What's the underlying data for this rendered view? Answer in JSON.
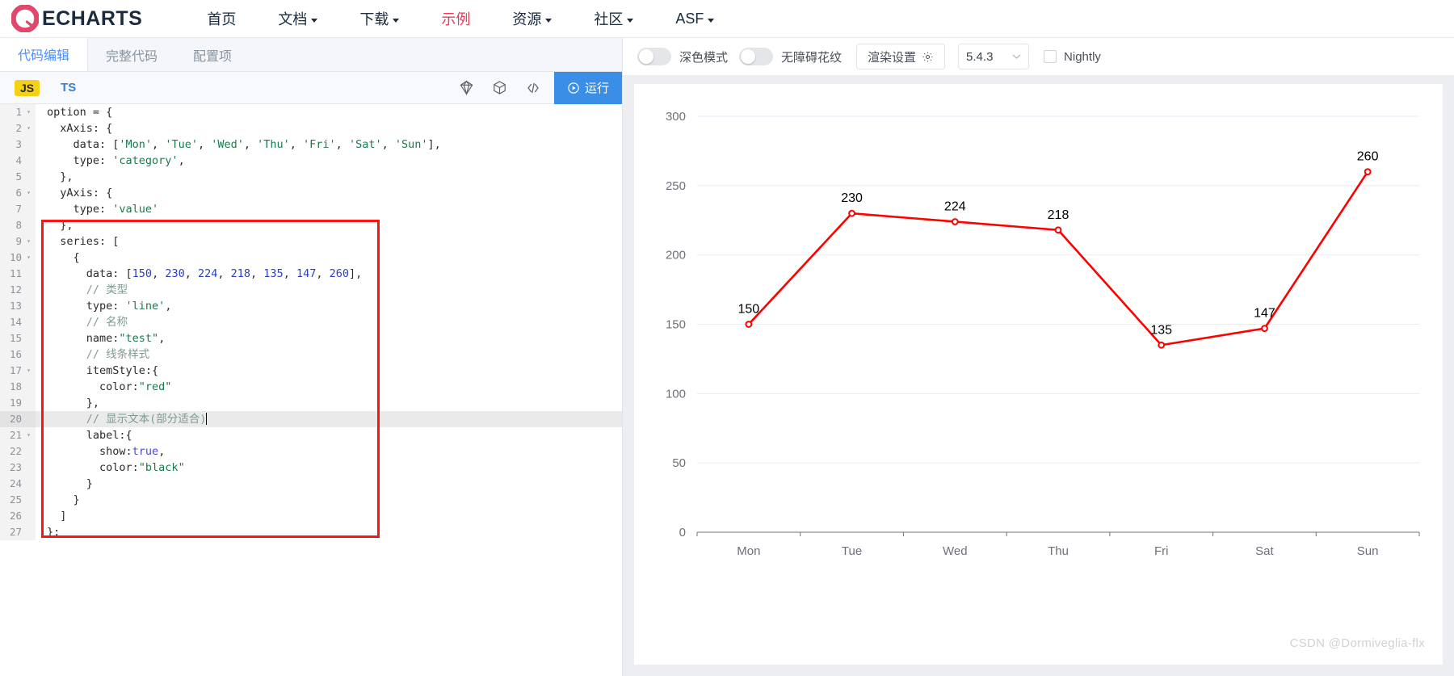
{
  "nav": {
    "brand": "ECHARTS",
    "items": [
      {
        "label": "首页",
        "caret": false,
        "active": false
      },
      {
        "label": "文档",
        "caret": true,
        "active": false
      },
      {
        "label": "下载",
        "caret": true,
        "active": false
      },
      {
        "label": "示例",
        "caret": false,
        "active": true
      },
      {
        "label": "资源",
        "caret": true,
        "active": false
      },
      {
        "label": "社区",
        "caret": true,
        "active": false
      },
      {
        "label": "ASF",
        "caret": true,
        "active": false
      }
    ],
    "accent_color": "#e43c59",
    "text_color": "#1b2a3c"
  },
  "editor_panel": {
    "tabs": [
      {
        "label": "代码编辑",
        "active": true
      },
      {
        "label": "完整代码",
        "active": false
      },
      {
        "label": "配置项",
        "active": false
      }
    ],
    "toolbar": {
      "js_label": "JS",
      "ts_label": "TS",
      "run_label": "运行",
      "icons": [
        "gem-icon",
        "cube-icon",
        "code-brackets-icon"
      ]
    },
    "highlight_box_color": "#fb1414",
    "active_line": 20,
    "lines": [
      {
        "n": 1,
        "fold": true,
        "segs": [
          {
            "t": "option ",
            "c": "pun"
          },
          {
            "t": "= {",
            "c": "pun"
          }
        ]
      },
      {
        "n": 2,
        "fold": true,
        "segs": [
          {
            "t": "  xAxis: {",
            "c": "pun"
          }
        ]
      },
      {
        "n": 3,
        "fold": false,
        "segs": [
          {
            "t": "    data: [",
            "c": "pun"
          },
          {
            "t": "'Mon'",
            "c": "str"
          },
          {
            "t": ", ",
            "c": "pun"
          },
          {
            "t": "'Tue'",
            "c": "str"
          },
          {
            "t": ", ",
            "c": "pun"
          },
          {
            "t": "'Wed'",
            "c": "str"
          },
          {
            "t": ", ",
            "c": "pun"
          },
          {
            "t": "'Thu'",
            "c": "str"
          },
          {
            "t": ", ",
            "c": "pun"
          },
          {
            "t": "'Fri'",
            "c": "str"
          },
          {
            "t": ", ",
            "c": "pun"
          },
          {
            "t": "'Sat'",
            "c": "str"
          },
          {
            "t": ", ",
            "c": "pun"
          },
          {
            "t": "'Sun'",
            "c": "str"
          },
          {
            "t": "],",
            "c": "pun"
          }
        ]
      },
      {
        "n": 4,
        "fold": false,
        "segs": [
          {
            "t": "    type: ",
            "c": "pun"
          },
          {
            "t": "'category'",
            "c": "str"
          },
          {
            "t": ",",
            "c": "pun"
          }
        ]
      },
      {
        "n": 5,
        "fold": false,
        "segs": [
          {
            "t": "  },",
            "c": "pun"
          }
        ]
      },
      {
        "n": 6,
        "fold": true,
        "segs": [
          {
            "t": "  yAxis: {",
            "c": "pun"
          }
        ]
      },
      {
        "n": 7,
        "fold": false,
        "segs": [
          {
            "t": "    type: ",
            "c": "pun"
          },
          {
            "t": "'value'",
            "c": "str"
          }
        ]
      },
      {
        "n": 8,
        "fold": false,
        "segs": [
          {
            "t": "  },",
            "c": "pun"
          }
        ]
      },
      {
        "n": 9,
        "fold": true,
        "segs": [
          {
            "t": "  series: [",
            "c": "pun"
          }
        ]
      },
      {
        "n": 10,
        "fold": true,
        "segs": [
          {
            "t": "    {",
            "c": "pun"
          }
        ]
      },
      {
        "n": 11,
        "fold": false,
        "segs": [
          {
            "t": "      data: [",
            "c": "pun"
          },
          {
            "t": "150",
            "c": "num"
          },
          {
            "t": ", ",
            "c": "pun"
          },
          {
            "t": "230",
            "c": "num"
          },
          {
            "t": ", ",
            "c": "pun"
          },
          {
            "t": "224",
            "c": "num"
          },
          {
            "t": ", ",
            "c": "pun"
          },
          {
            "t": "218",
            "c": "num"
          },
          {
            "t": ", ",
            "c": "pun"
          },
          {
            "t": "135",
            "c": "num"
          },
          {
            "t": ", ",
            "c": "pun"
          },
          {
            "t": "147",
            "c": "num"
          },
          {
            "t": ", ",
            "c": "pun"
          },
          {
            "t": "260",
            "c": "num"
          },
          {
            "t": "],",
            "c": "pun"
          }
        ]
      },
      {
        "n": 12,
        "fold": false,
        "segs": [
          {
            "t": "      // 类型",
            "c": "com"
          }
        ]
      },
      {
        "n": 13,
        "fold": false,
        "segs": [
          {
            "t": "      type: ",
            "c": "pun"
          },
          {
            "t": "'line'",
            "c": "str"
          },
          {
            "t": ",",
            "c": "pun"
          }
        ]
      },
      {
        "n": 14,
        "fold": false,
        "segs": [
          {
            "t": "      // 名称",
            "c": "com"
          }
        ]
      },
      {
        "n": 15,
        "fold": false,
        "segs": [
          {
            "t": "      name:",
            "c": "pun"
          },
          {
            "t": "\"test\"",
            "c": "str"
          },
          {
            "t": ",",
            "c": "pun"
          }
        ]
      },
      {
        "n": 16,
        "fold": false,
        "segs": [
          {
            "t": "      // 线条样式",
            "c": "com"
          }
        ]
      },
      {
        "n": 17,
        "fold": true,
        "segs": [
          {
            "t": "      itemStyle:{",
            "c": "pun"
          }
        ]
      },
      {
        "n": 18,
        "fold": false,
        "segs": [
          {
            "t": "        color:",
            "c": "pun"
          },
          {
            "t": "\"red\"",
            "c": "str"
          }
        ]
      },
      {
        "n": 19,
        "fold": false,
        "segs": [
          {
            "t": "      },",
            "c": "pun"
          }
        ]
      },
      {
        "n": 20,
        "fold": false,
        "segs": [
          {
            "t": "      // 显示文本(部分适合)",
            "c": "com"
          }
        ],
        "cursor_after": "      // 显示文本(部分适合"
      },
      {
        "n": 21,
        "fold": true,
        "segs": [
          {
            "t": "      label:{",
            "c": "pun"
          }
        ]
      },
      {
        "n": 22,
        "fold": false,
        "segs": [
          {
            "t": "        show:",
            "c": "pun"
          },
          {
            "t": "true",
            "c": "key"
          },
          {
            "t": ",",
            "c": "pun"
          }
        ]
      },
      {
        "n": 23,
        "fold": false,
        "segs": [
          {
            "t": "        color:",
            "c": "pun"
          },
          {
            "t": "\"black\"",
            "c": "str"
          }
        ]
      },
      {
        "n": 24,
        "fold": false,
        "segs": [
          {
            "t": "      }",
            "c": "pun"
          }
        ]
      },
      {
        "n": 25,
        "fold": false,
        "segs": [
          {
            "t": "    }",
            "c": "pun"
          }
        ]
      },
      {
        "n": 26,
        "fold": false,
        "segs": [
          {
            "t": "  ]",
            "c": "pun"
          }
        ]
      },
      {
        "n": 27,
        "fold": false,
        "segs": [
          {
            "t": "};",
            "c": "pun"
          }
        ]
      }
    ]
  },
  "preview_panel": {
    "dark_mode_label": "深色模式",
    "dark_mode_on": false,
    "accessibility_label": "无障碍花纹",
    "accessibility_on": false,
    "render_settings_label": "渲染设置",
    "render_settings_icon": "gear-icon",
    "version": "5.4.3",
    "nightly_label": "Nightly",
    "nightly_checked": false,
    "watermark": "CSDN @Dormiveglia-flx"
  },
  "chart_data": {
    "type": "line",
    "title": "",
    "xlabel": "",
    "ylabel": "",
    "categories": [
      "Mon",
      "Tue",
      "Wed",
      "Thu",
      "Fri",
      "Sat",
      "Sun"
    ],
    "series": [
      {
        "name": "test",
        "values": [
          150,
          230,
          224,
          218,
          135,
          147,
          260
        ],
        "color": "#ff0000"
      }
    ],
    "ylim": [
      0,
      300
    ],
    "yticks": [
      0,
      50,
      100,
      150,
      200,
      250,
      300
    ],
    "grid": true,
    "legend": "none",
    "data_labels_shown": true,
    "data_label_color": "#000000",
    "symbol": "circle",
    "axis_label_color": "#6e7079"
  }
}
